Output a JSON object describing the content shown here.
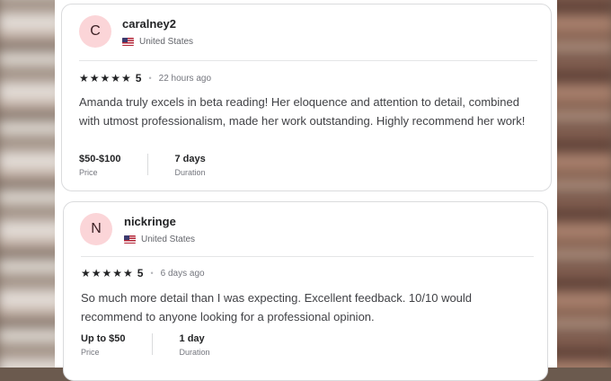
{
  "reviews": [
    {
      "initial": "C",
      "username": "caralney2",
      "country": "United States",
      "stars": "★★★★★",
      "score": "5",
      "time": "22 hours ago",
      "text": "Amanda truly excels in beta reading! Her eloquence and attention to detail, combined with utmost professionalism, made her work outstanding. Highly recommend her work!",
      "price_value": "$50-$100",
      "price_label": "Price",
      "duration_value": "7 days",
      "duration_label": "Duration"
    },
    {
      "initial": "N",
      "username": "nickringe",
      "country": "United States",
      "stars": "★★★★★",
      "score": "5",
      "time": "6 days ago",
      "text": "So much more detail than I was expecting. Excellent feedback. 10/10 would recommend to anyone looking for a professional opinion.",
      "price_value": "Up to $50",
      "price_label": "Price",
      "duration_value": "1 day",
      "duration_label": "Duration"
    }
  ],
  "colors": {
    "avatar_bg": "#fbd5d8",
    "border": "#dadbdd",
    "text": "#404145"
  },
  "icons": {
    "flag": "us-flag-icon",
    "star": "star-icon"
  }
}
